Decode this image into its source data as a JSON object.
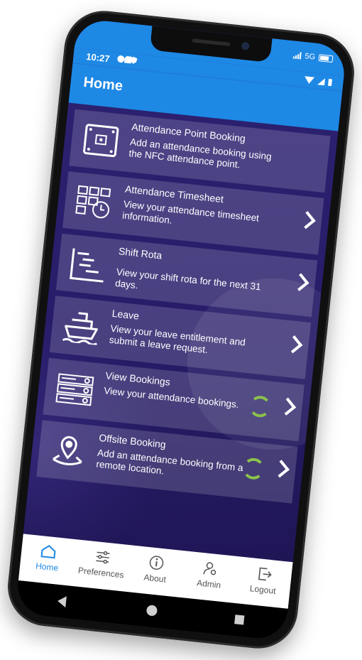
{
  "carrier": {
    "network": "5G"
  },
  "status_bar": {
    "time": "10:27"
  },
  "app_bar": {
    "title": "Home"
  },
  "menu": [
    {
      "title": "Attendance Point Booking",
      "desc": "Add an attendance booking using the NFC attendance point.",
      "icon": "nfc-reader-icon"
    },
    {
      "title": "Attendance Timesheet",
      "desc": "View your attendance timesheet information.",
      "icon": "timesheet-icon"
    },
    {
      "title": "Shift Rota",
      "desc": "View your shift rota for the next 31 days.",
      "icon": "rota-icon"
    },
    {
      "title": "Leave",
      "desc": "View your leave entitlement and submit a leave request.",
      "icon": "ship-icon"
    },
    {
      "title": "View Bookings",
      "desc": "View your attendance bookings.",
      "icon": "bookings-icon"
    },
    {
      "title": "Offsite Booking",
      "desc": "Add an attendance booking from a remote location.",
      "icon": "location-pin-icon"
    }
  ],
  "bottom_nav": [
    {
      "label": "Home",
      "icon": "home-icon"
    },
    {
      "label": "Preferences",
      "icon": "sliders-icon"
    },
    {
      "label": "About",
      "icon": "info-icon"
    },
    {
      "label": "Admin",
      "icon": "admin-icon"
    },
    {
      "label": "Logout",
      "icon": "logout-icon"
    }
  ],
  "colors": {
    "primary": "#1e88e5",
    "background": "#271c68",
    "sync": "#8bc34a"
  }
}
